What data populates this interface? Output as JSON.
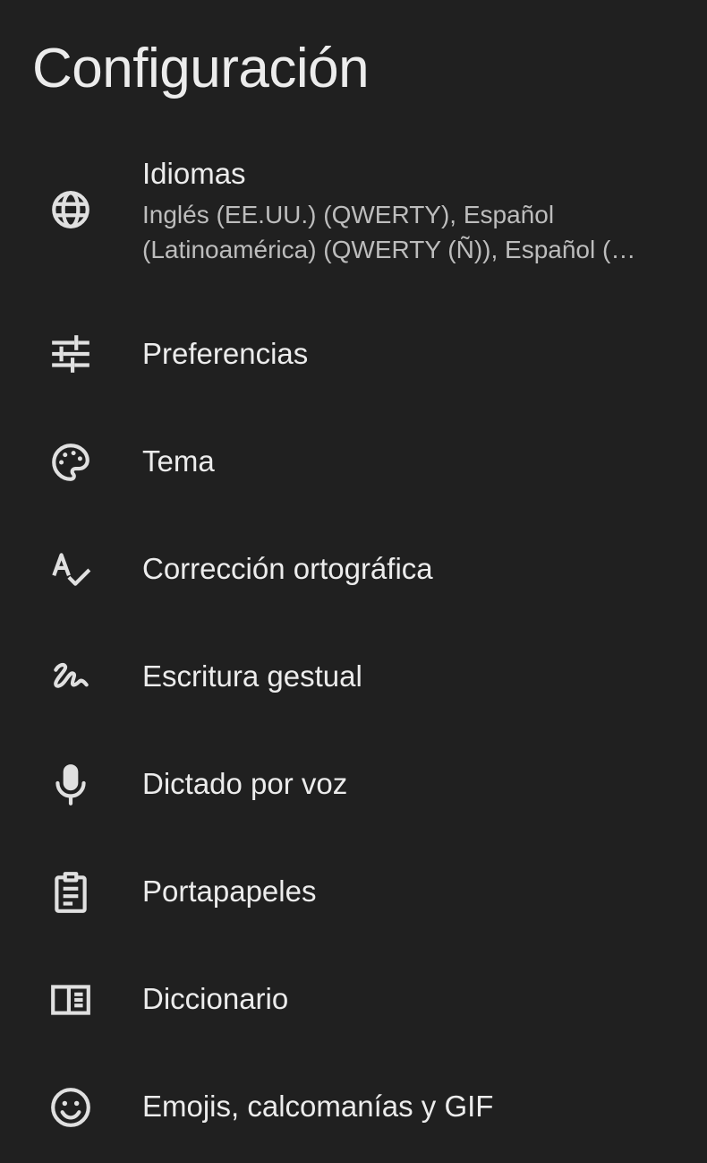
{
  "header": {
    "title": "Configuración"
  },
  "settings": {
    "items": [
      {
        "icon": "globe-icon",
        "label": "Idiomas",
        "sublabel": "Inglés (EE.UU.) (QWERTY), Español (Latinoamérica) (QWERTY (Ñ)), Español (…"
      },
      {
        "icon": "sliders-icon",
        "label": "Preferencias"
      },
      {
        "icon": "palette-icon",
        "label": "Tema"
      },
      {
        "icon": "spellcheck-icon",
        "label": "Corrección ortográfica"
      },
      {
        "icon": "gesture-icon",
        "label": "Escritura gestual"
      },
      {
        "icon": "microphone-icon",
        "label": "Dictado por voz"
      },
      {
        "icon": "clipboard-icon",
        "label": "Portapapeles"
      },
      {
        "icon": "dictionary-book-icon",
        "label": "Diccionario"
      },
      {
        "icon": "emoji-smiley-icon",
        "label": "Emojis, calcomanías y GIF"
      }
    ]
  },
  "colors": {
    "background": "#202020",
    "text_primary": "#ececec",
    "text_secondary": "#bdbdbd",
    "icon": "#e0e0e0"
  }
}
